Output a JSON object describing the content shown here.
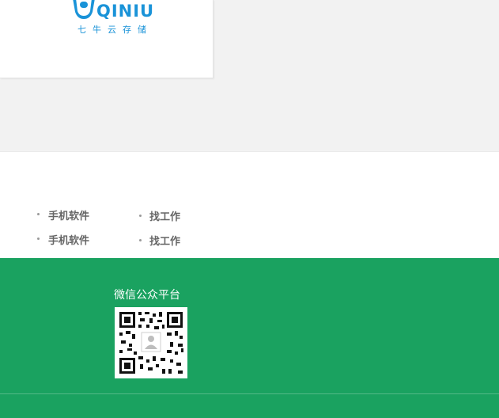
{
  "partner": {
    "logo_word": "QINIU",
    "logo_subtitle": "七牛云存储",
    "logo_color": "#1a93d8"
  },
  "links": [
    {
      "label": "手机软件"
    },
    {
      "label": "找工作"
    },
    {
      "label": "手机软件"
    },
    {
      "label": "找工作"
    }
  ],
  "footer": {
    "wechat_title": "微信公众平台",
    "background": "#1aa260"
  }
}
